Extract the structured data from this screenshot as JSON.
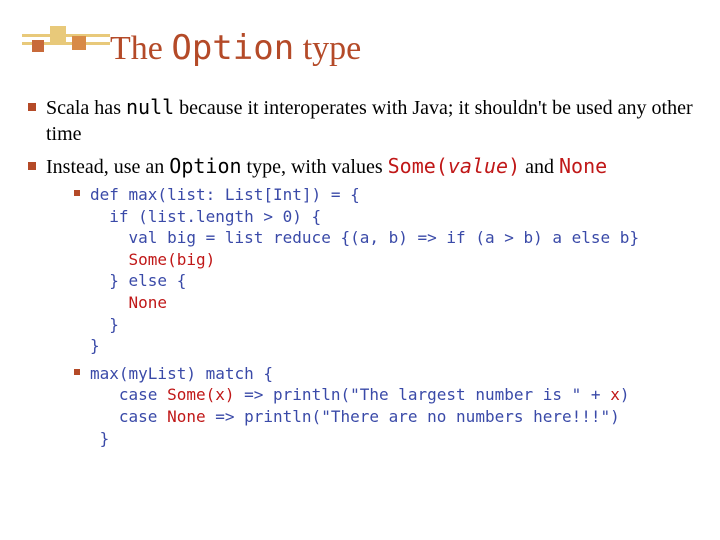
{
  "title": {
    "pre": "The ",
    "code": "Option",
    "post": " type"
  },
  "bullets": [
    {
      "parts": [
        {
          "t": "Scala has "
        },
        {
          "t": "null",
          "mono": true
        },
        {
          "t": " because it interoperates with Java; it shouldn't be used any other time"
        }
      ]
    },
    {
      "parts": [
        {
          "t": "Instead, use an "
        },
        {
          "t": "Option",
          "mono": true
        },
        {
          "t": " type, with values "
        },
        {
          "t": "Some(",
          "mono": true,
          "red": true
        },
        {
          "t": "value",
          "mono": true,
          "red": true,
          "ital": true
        },
        {
          "t": ")",
          "mono": true,
          "red": true
        },
        {
          "t": " and "
        },
        {
          "t": "None",
          "mono": true,
          "red": true
        }
      ],
      "subs": [
        {
          "lines": [
            [
              {
                "t": "def max(list: List[Int]) = {"
              }
            ],
            [
              {
                "t": "  if (list.length > 0) {"
              }
            ],
            [
              {
                "t": "    val big = list reduce {(a, b) => if (a > b) a else b}"
              }
            ],
            [
              {
                "t": "    "
              },
              {
                "t": "Some(big)",
                "red": true
              }
            ],
            [
              {
                "t": "  } else {"
              }
            ],
            [
              {
                "t": "    "
              },
              {
                "t": "None",
                "red": true
              }
            ],
            [
              {
                "t": "  }"
              }
            ],
            [
              {
                "t": "}"
              }
            ]
          ]
        },
        {
          "lines": [
            [
              {
                "t": "max(myList) match {"
              }
            ],
            [
              {
                "t": "   case "
              },
              {
                "t": "Some(x)",
                "red": true
              },
              {
                "t": " => println(\"The largest number is \" + "
              },
              {
                "t": "x",
                "red": true
              },
              {
                "t": ")"
              }
            ],
            [
              {
                "t": "   case "
              },
              {
                "t": "None",
                "red": true
              },
              {
                "t": " => println(\"There are no numbers here!!!\")"
              }
            ],
            [
              {
                "t": " }"
              }
            ]
          ]
        }
      ]
    }
  ]
}
